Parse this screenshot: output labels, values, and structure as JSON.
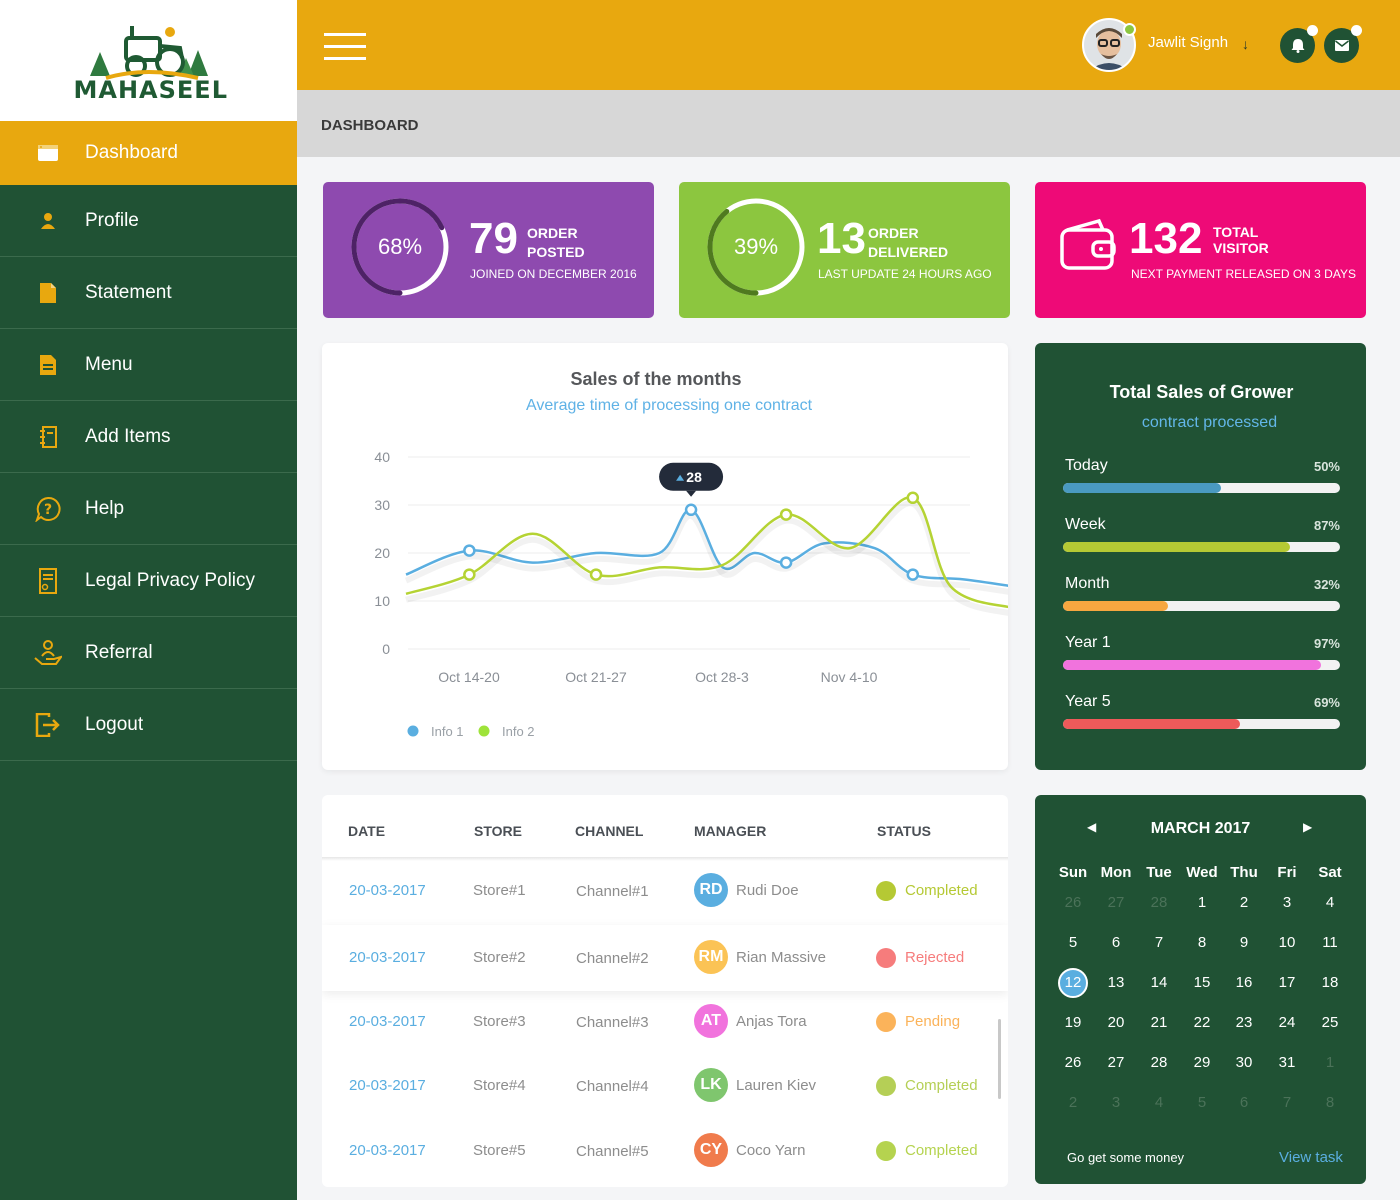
{
  "brand": {
    "name": "MAHASEEL"
  },
  "sidebar": {
    "items": [
      {
        "label": "Dashboard",
        "icon": "browser-window-icon",
        "active": true
      },
      {
        "label": "Profile",
        "icon": "user-icon"
      },
      {
        "label": "Statement",
        "icon": "document-icon"
      },
      {
        "label": "Menu",
        "icon": "list-document-icon"
      },
      {
        "label": "Add Items",
        "icon": "notebook-icon"
      },
      {
        "label": "Help",
        "icon": "question-icon"
      },
      {
        "label": "Legal Privacy Policy",
        "icon": "policy-doc-icon"
      },
      {
        "label": "Referral",
        "icon": "hand-person-icon"
      },
      {
        "label": "Logout",
        "icon": "logout-icon"
      }
    ]
  },
  "header": {
    "user_name": "Jawlit Signh",
    "user_arrow": "↓",
    "page_title": "DASHBOARD"
  },
  "stats": [
    {
      "percent": "68%",
      "progress": 0.68,
      "number": "79",
      "label_1": "ORDER",
      "label_2": "POSTED",
      "sub": "JOINED ON DECEMBER 2016",
      "color": "#8e4aaf"
    },
    {
      "percent": "39%",
      "progress": 0.39,
      "number": "13",
      "label_1": "ORDER",
      "label_2": "DELIVERED",
      "sub": "LAST UPDATE 24 HOURS AGO",
      "color": "#8cc63f"
    },
    {
      "number": "132",
      "label_1": "TOTAL",
      "label_2": "VISITOR",
      "sub": "NEXT PAYMENT  RELEASED ON 3 DAYS",
      "color": "#ee0a77",
      "icon": "wallet-icon"
    }
  ],
  "chart_data": {
    "type": "line",
    "title": "Sales of the months",
    "subtitle": "Average time of processing one contract",
    "categories": [
      "Oct 14-20",
      "Oct 21-27",
      "Oct 28-3",
      "Nov 4-10"
    ],
    "ylim": [
      0,
      40
    ],
    "yticks": [
      "40",
      "30",
      "20",
      "10",
      "0"
    ],
    "grid": true,
    "legend_position": "bottom-left",
    "tooltip": {
      "value": "28",
      "series": "Info 1"
    },
    "series": [
      {
        "name": "Info 1",
        "color": "#5aaee0",
        "points": [
          [
            0,
            15.5
          ],
          [
            0.5,
            20.5
          ],
          [
            1,
            18
          ],
          [
            1.5,
            20
          ],
          [
            2,
            20
          ],
          [
            2.25,
            29
          ],
          [
            2.5,
            17
          ],
          [
            2.75,
            20
          ],
          [
            3,
            18
          ],
          [
            3.3,
            22
          ],
          [
            3.7,
            21
          ],
          [
            4,
            15.5
          ],
          [
            4.4,
            14.5
          ],
          [
            4.8,
            13
          ]
        ],
        "markers": [
          [
            0.5,
            20.5
          ],
          [
            2.25,
            29
          ],
          [
            3,
            18
          ],
          [
            4,
            15.5
          ]
        ]
      },
      {
        "name": "Info 2",
        "color": "#b5d334",
        "points": [
          [
            0,
            11.5
          ],
          [
            0.5,
            15.5
          ],
          [
            1,
            24
          ],
          [
            1.5,
            15.5
          ],
          [
            2,
            17
          ],
          [
            2.5,
            17.5
          ],
          [
            3,
            28
          ],
          [
            3.5,
            21
          ],
          [
            4,
            31.5
          ],
          [
            4.3,
            13
          ],
          [
            4.8,
            8.5
          ]
        ],
        "markers": [
          [
            0.5,
            15.5
          ],
          [
            1.5,
            15.5
          ],
          [
            3,
            28
          ],
          [
            4,
            31.5
          ]
        ]
      }
    ]
  },
  "grower": {
    "title": "Total Sales of Grower",
    "subtitle": "contract processed",
    "bars": [
      {
        "label": "Today",
        "percent": "50%",
        "value": 0.57,
        "color": "#4a9ac1"
      },
      {
        "label": "Week",
        "percent": "87%",
        "value": 0.82,
        "color": "#b5c934"
      },
      {
        "label": "Month",
        "percent": "32%",
        "value": 0.38,
        "color": "#f6a740"
      },
      {
        "label": "Year 1",
        "percent": "97%",
        "value": 0.93,
        "color": "#f173dd"
      },
      {
        "label": "Year 5",
        "percent": "69%",
        "value": 0.64,
        "color": "#ee5a5a"
      }
    ]
  },
  "table": {
    "headers": [
      "DATE",
      "STORE",
      "CHANNEL",
      "MANAGER",
      "STATUS"
    ],
    "rows": [
      {
        "date": "20-03-2017",
        "store": "Store#1",
        "channel": "Channel#1",
        "initials": "RD",
        "avatar_color": "#5aaee0",
        "manager": "Rudi Doe",
        "status": "Completed",
        "status_color": "#b5c934"
      },
      {
        "date": "20-03-2017",
        "store": "Store#2",
        "channel": "Channel#2",
        "initials": "RM",
        "avatar_color": "#fbc355",
        "manager": "Rian Massive",
        "status": "Rejected",
        "status_color": "#f67c7c"
      },
      {
        "date": "20-03-2017",
        "store": "Store#3",
        "channel": "Channel#3",
        "initials": "AT",
        "avatar_color": "#f173dd",
        "manager": "Anjas Tora",
        "status": "Pending",
        "status_color": "#fbb35a"
      },
      {
        "date": "20-03-2017",
        "store": "Store#4",
        "channel": "Channel#4",
        "initials": "LK",
        "avatar_color": "#7fc66e",
        "manager": "Lauren Kiev",
        "status": "Completed",
        "status_color": "#b5cf56"
      },
      {
        "date": "20-03-2017",
        "store": "Store#5",
        "channel": "Channel#5",
        "initials": "CY",
        "avatar_color": "#f07b4c",
        "manager": "Coco Yarn",
        "status": "Completed",
        "status_color": "#b5d34f"
      }
    ]
  },
  "calendar": {
    "month": "MARCH 2017",
    "prev": "◀",
    "next": "▶",
    "weekdays": [
      "Sun",
      "Mon",
      "Tue",
      "Wed",
      "Thu",
      "Fri",
      "Sat"
    ],
    "weeks": [
      [
        "26",
        "27",
        "28",
        "1",
        "2",
        "3",
        "4"
      ],
      [
        "5",
        "6",
        "7",
        "8",
        "9",
        "10",
        "11"
      ],
      [
        "12",
        "13",
        "14",
        "15",
        "16",
        "17",
        "18"
      ],
      [
        "19",
        "20",
        "21",
        "22",
        "23",
        "24",
        "25"
      ],
      [
        "26",
        "27",
        "28",
        "29",
        "30",
        "31",
        "1"
      ],
      [
        "2",
        "3",
        "4",
        "5",
        "6",
        "7",
        "8"
      ]
    ],
    "today": "12",
    "footer_left": "Go get some money",
    "footer_link": "View task"
  }
}
